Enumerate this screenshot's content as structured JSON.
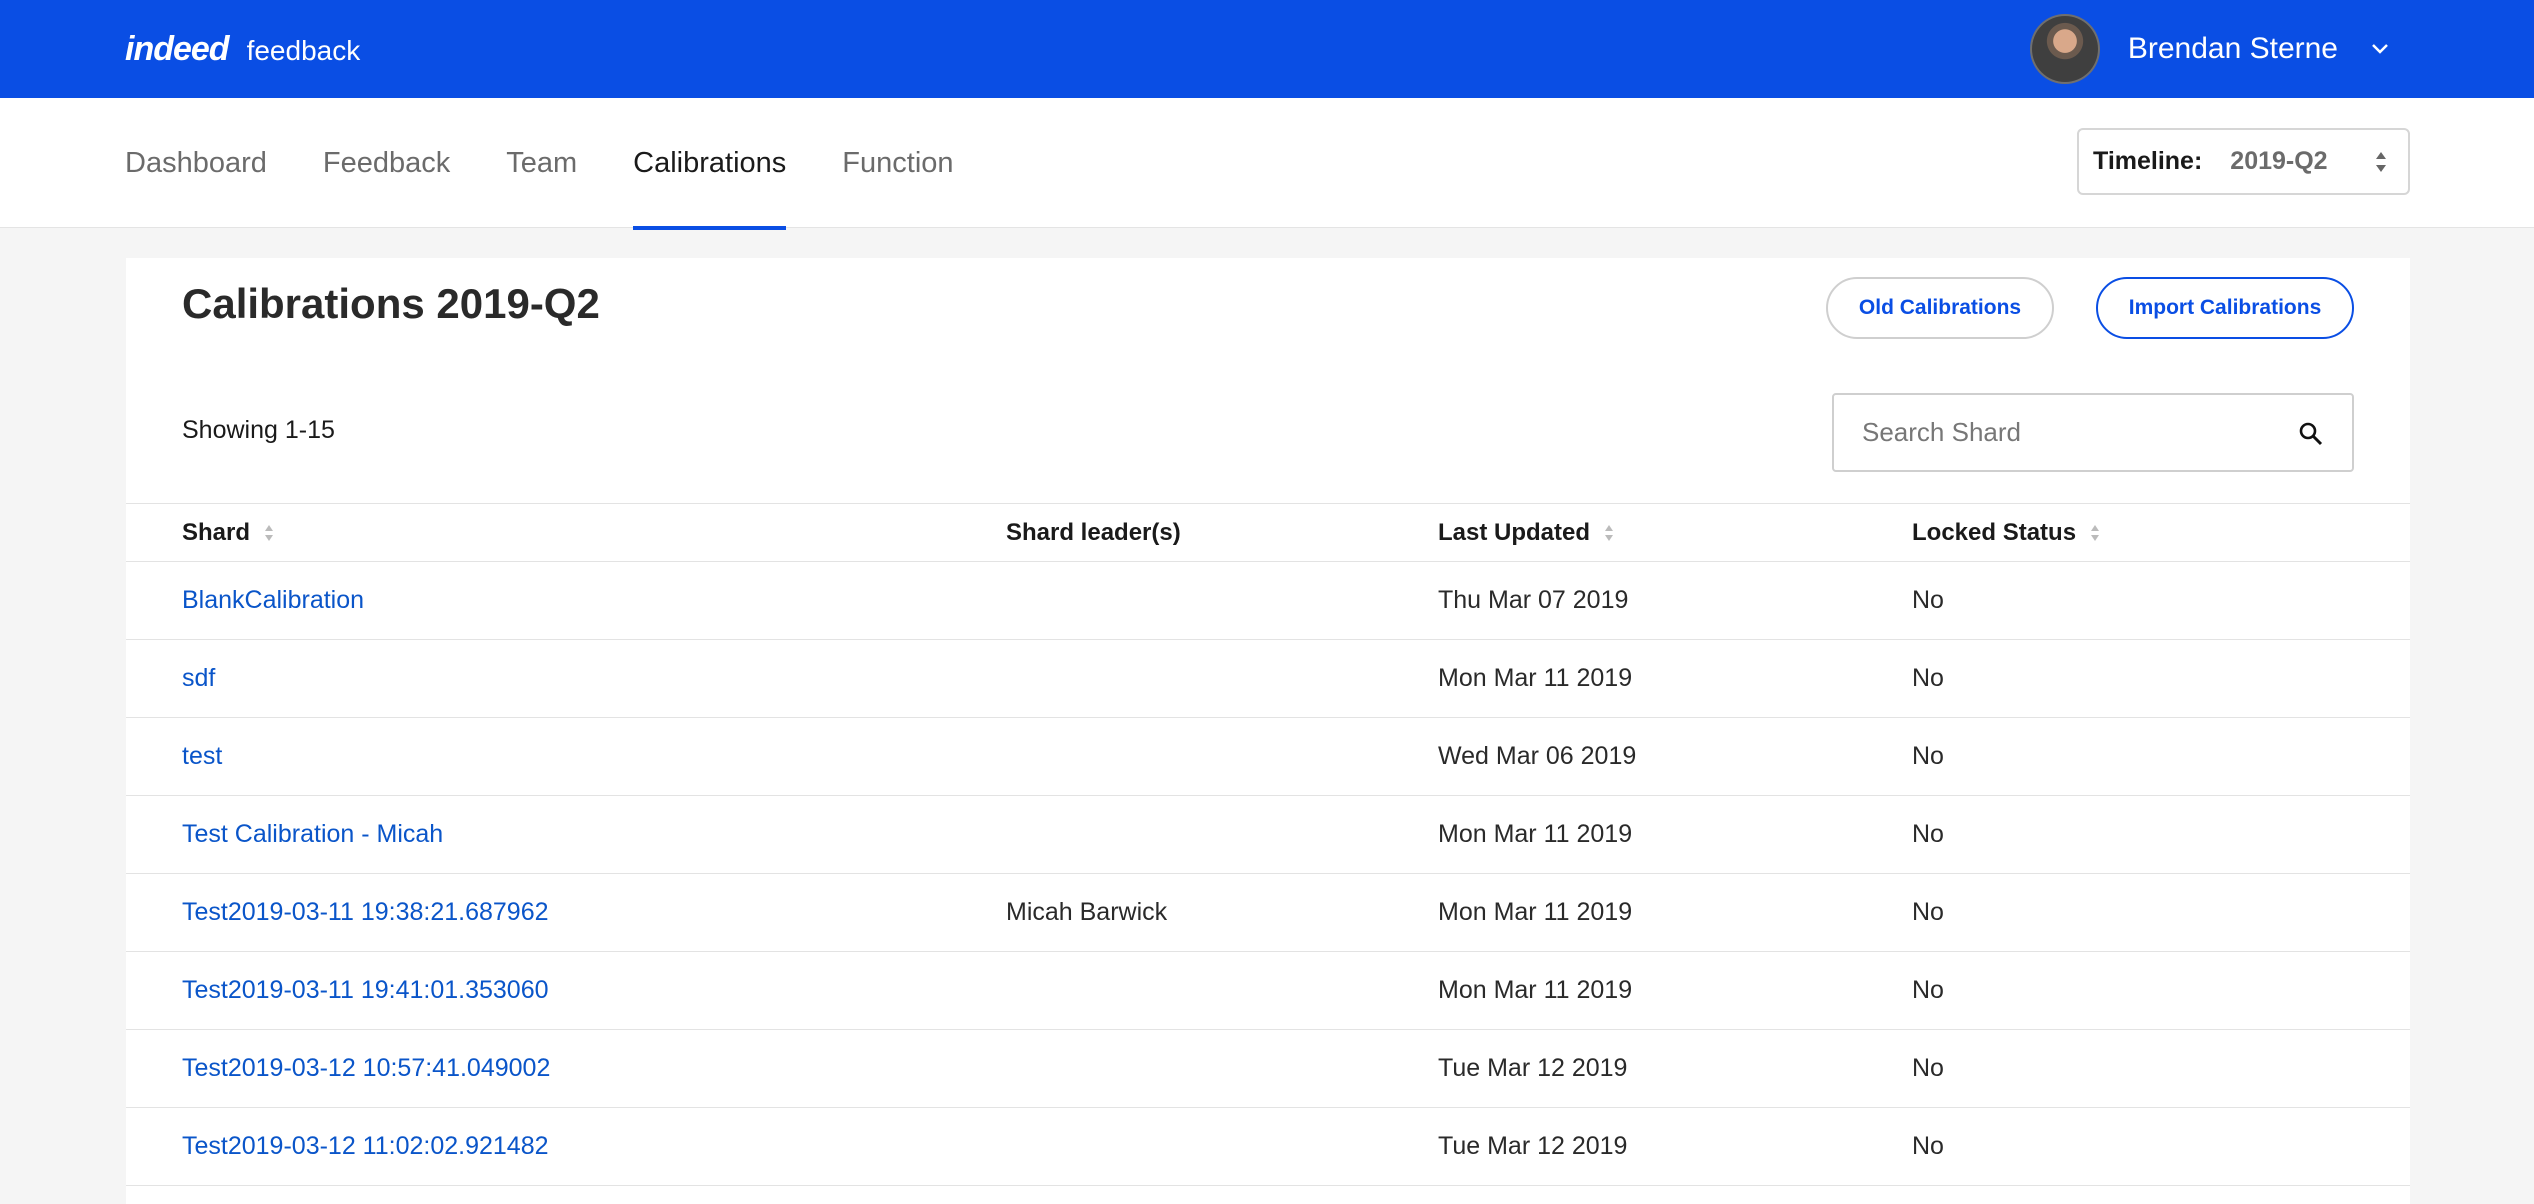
{
  "header": {
    "brand": "indeed",
    "product": "feedback",
    "user_name": "Brendan Sterne"
  },
  "nav": {
    "tabs": [
      {
        "label": "Dashboard",
        "active": false
      },
      {
        "label": "Feedback",
        "active": false
      },
      {
        "label": "Team",
        "active": false
      },
      {
        "label": "Calibrations",
        "active": true
      },
      {
        "label": "Function",
        "active": false
      }
    ],
    "timeline_label": "Timeline:",
    "timeline_value": "2019-Q2"
  },
  "page": {
    "title": "Calibrations 2019-Q2",
    "old_button": "Old Calibrations",
    "import_button": "Import Calibrations",
    "showing": "Showing 1-15",
    "search_placeholder": "Search Shard"
  },
  "table": {
    "headers": [
      "Shard",
      "Shard leader(s)",
      "Last Updated",
      "Locked Status"
    ],
    "rows": [
      {
        "shard": "BlankCalibration",
        "leader": "",
        "updated": "Thu Mar 07 2019",
        "locked": "No"
      },
      {
        "shard": "sdf",
        "leader": "",
        "updated": "Mon Mar 11 2019",
        "locked": "No"
      },
      {
        "shard": "test",
        "leader": "",
        "updated": "Wed Mar 06 2019",
        "locked": "No"
      },
      {
        "shard": "Test Calibration - Micah",
        "leader": "",
        "updated": "Mon Mar 11 2019",
        "locked": "No"
      },
      {
        "shard": "Test2019-03-11 19:38:21.687962",
        "leader": "Micah Barwick",
        "updated": "Mon Mar 11 2019",
        "locked": "No"
      },
      {
        "shard": "Test2019-03-11 19:41:01.353060",
        "leader": "",
        "updated": "Mon Mar 11 2019",
        "locked": "No"
      },
      {
        "shard": "Test2019-03-12 10:57:41.049002",
        "leader": "",
        "updated": "Tue Mar 12 2019",
        "locked": "No"
      },
      {
        "shard": "Test2019-03-12 11:02:02.921482",
        "leader": "",
        "updated": "Tue Mar 12 2019",
        "locked": "No"
      }
    ]
  },
  "colors": {
    "brand_blue": "#0a4ee4",
    "link_blue": "#0a55c9"
  }
}
